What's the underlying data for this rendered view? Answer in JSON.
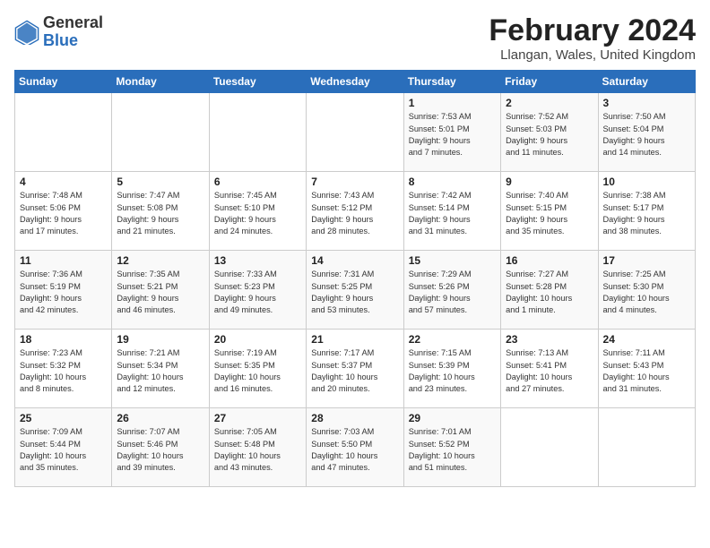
{
  "header": {
    "logo_general": "General",
    "logo_blue": "Blue",
    "month_year": "February 2024",
    "location": "Llangan, Wales, United Kingdom"
  },
  "days_of_week": [
    "Sunday",
    "Monday",
    "Tuesday",
    "Wednesday",
    "Thursday",
    "Friday",
    "Saturday"
  ],
  "weeks": [
    [
      {
        "day": "",
        "info": ""
      },
      {
        "day": "",
        "info": ""
      },
      {
        "day": "",
        "info": ""
      },
      {
        "day": "",
        "info": ""
      },
      {
        "day": "1",
        "info": "Sunrise: 7:53 AM\nSunset: 5:01 PM\nDaylight: 9 hours\nand 7 minutes."
      },
      {
        "day": "2",
        "info": "Sunrise: 7:52 AM\nSunset: 5:03 PM\nDaylight: 9 hours\nand 11 minutes."
      },
      {
        "day": "3",
        "info": "Sunrise: 7:50 AM\nSunset: 5:04 PM\nDaylight: 9 hours\nand 14 minutes."
      }
    ],
    [
      {
        "day": "4",
        "info": "Sunrise: 7:48 AM\nSunset: 5:06 PM\nDaylight: 9 hours\nand 17 minutes."
      },
      {
        "day": "5",
        "info": "Sunrise: 7:47 AM\nSunset: 5:08 PM\nDaylight: 9 hours\nand 21 minutes."
      },
      {
        "day": "6",
        "info": "Sunrise: 7:45 AM\nSunset: 5:10 PM\nDaylight: 9 hours\nand 24 minutes."
      },
      {
        "day": "7",
        "info": "Sunrise: 7:43 AM\nSunset: 5:12 PM\nDaylight: 9 hours\nand 28 minutes."
      },
      {
        "day": "8",
        "info": "Sunrise: 7:42 AM\nSunset: 5:14 PM\nDaylight: 9 hours\nand 31 minutes."
      },
      {
        "day": "9",
        "info": "Sunrise: 7:40 AM\nSunset: 5:15 PM\nDaylight: 9 hours\nand 35 minutes."
      },
      {
        "day": "10",
        "info": "Sunrise: 7:38 AM\nSunset: 5:17 PM\nDaylight: 9 hours\nand 38 minutes."
      }
    ],
    [
      {
        "day": "11",
        "info": "Sunrise: 7:36 AM\nSunset: 5:19 PM\nDaylight: 9 hours\nand 42 minutes."
      },
      {
        "day": "12",
        "info": "Sunrise: 7:35 AM\nSunset: 5:21 PM\nDaylight: 9 hours\nand 46 minutes."
      },
      {
        "day": "13",
        "info": "Sunrise: 7:33 AM\nSunset: 5:23 PM\nDaylight: 9 hours\nand 49 minutes."
      },
      {
        "day": "14",
        "info": "Sunrise: 7:31 AM\nSunset: 5:25 PM\nDaylight: 9 hours\nand 53 minutes."
      },
      {
        "day": "15",
        "info": "Sunrise: 7:29 AM\nSunset: 5:26 PM\nDaylight: 9 hours\nand 57 minutes."
      },
      {
        "day": "16",
        "info": "Sunrise: 7:27 AM\nSunset: 5:28 PM\nDaylight: 10 hours\nand 1 minute."
      },
      {
        "day": "17",
        "info": "Sunrise: 7:25 AM\nSunset: 5:30 PM\nDaylight: 10 hours\nand 4 minutes."
      }
    ],
    [
      {
        "day": "18",
        "info": "Sunrise: 7:23 AM\nSunset: 5:32 PM\nDaylight: 10 hours\nand 8 minutes."
      },
      {
        "day": "19",
        "info": "Sunrise: 7:21 AM\nSunset: 5:34 PM\nDaylight: 10 hours\nand 12 minutes."
      },
      {
        "day": "20",
        "info": "Sunrise: 7:19 AM\nSunset: 5:35 PM\nDaylight: 10 hours\nand 16 minutes."
      },
      {
        "day": "21",
        "info": "Sunrise: 7:17 AM\nSunset: 5:37 PM\nDaylight: 10 hours\nand 20 minutes."
      },
      {
        "day": "22",
        "info": "Sunrise: 7:15 AM\nSunset: 5:39 PM\nDaylight: 10 hours\nand 23 minutes."
      },
      {
        "day": "23",
        "info": "Sunrise: 7:13 AM\nSunset: 5:41 PM\nDaylight: 10 hours\nand 27 minutes."
      },
      {
        "day": "24",
        "info": "Sunrise: 7:11 AM\nSunset: 5:43 PM\nDaylight: 10 hours\nand 31 minutes."
      }
    ],
    [
      {
        "day": "25",
        "info": "Sunrise: 7:09 AM\nSunset: 5:44 PM\nDaylight: 10 hours\nand 35 minutes."
      },
      {
        "day": "26",
        "info": "Sunrise: 7:07 AM\nSunset: 5:46 PM\nDaylight: 10 hours\nand 39 minutes."
      },
      {
        "day": "27",
        "info": "Sunrise: 7:05 AM\nSunset: 5:48 PM\nDaylight: 10 hours\nand 43 minutes."
      },
      {
        "day": "28",
        "info": "Sunrise: 7:03 AM\nSunset: 5:50 PM\nDaylight: 10 hours\nand 47 minutes."
      },
      {
        "day": "29",
        "info": "Sunrise: 7:01 AM\nSunset: 5:52 PM\nDaylight: 10 hours\nand 51 minutes."
      },
      {
        "day": "",
        "info": ""
      },
      {
        "day": "",
        "info": ""
      }
    ]
  ]
}
